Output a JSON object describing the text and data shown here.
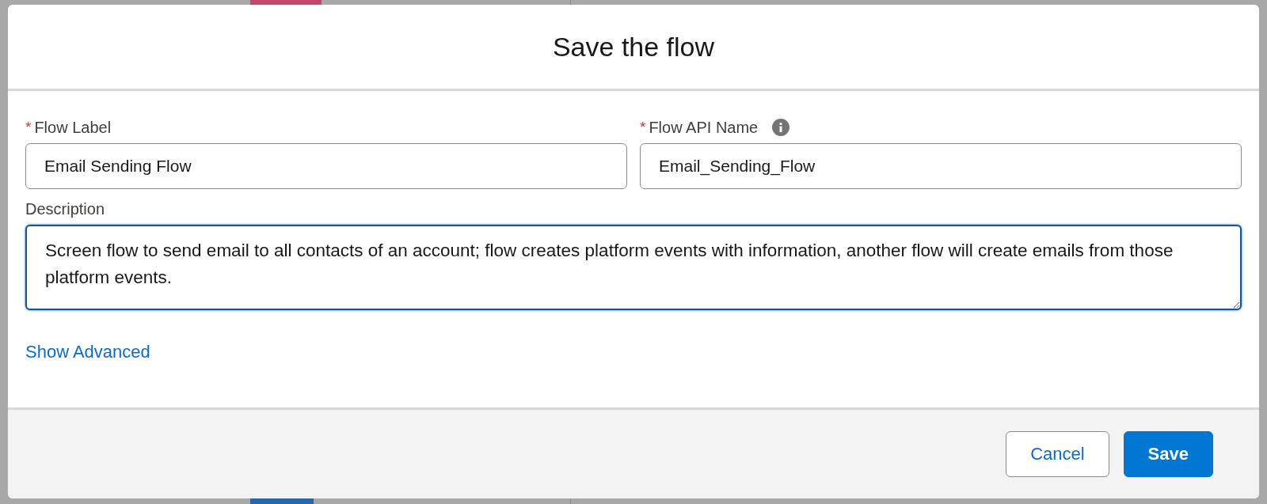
{
  "modal": {
    "title": "Save the flow",
    "fields": [
      {
        "label": "Flow Label",
        "required_mark": "*",
        "info": false,
        "value": "Email Sending Flow"
      },
      {
        "label": "Flow API Name",
        "required_mark": "*",
        "info": true,
        "value": "Email_Sending_Flow"
      }
    ],
    "description": {
      "label": "Description",
      "value": "Screen flow to send email to all contacts of an account; flow creates platform events with information, another flow will create emails from those platform events.",
      "focused": true
    },
    "link": "Show Advanced",
    "buttons": [
      {
        "label": "Cancel",
        "kind": "neutral"
      },
      {
        "label": "Save",
        "kind": "brand"
      }
    ]
  }
}
